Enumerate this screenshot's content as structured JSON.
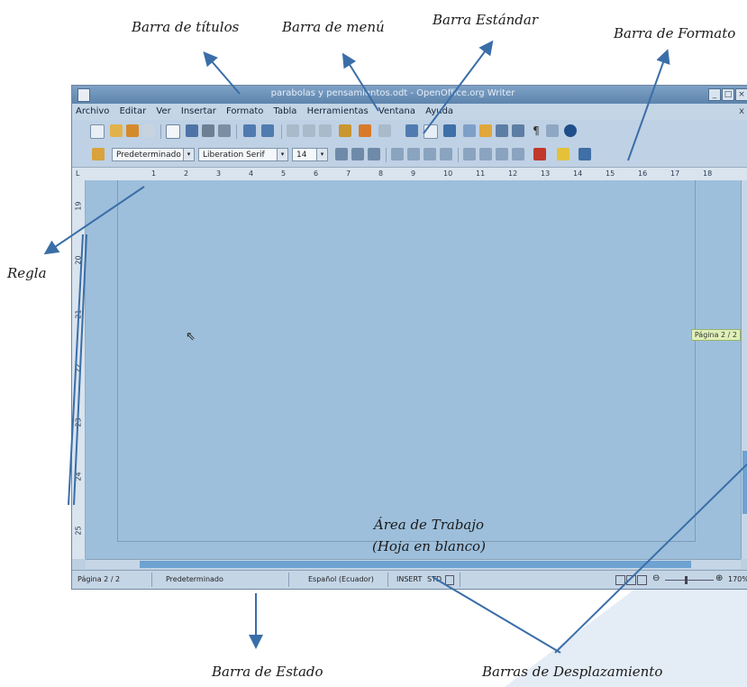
{
  "annotations": {
    "titulos": "Barra de títulos",
    "menu": "Barra de menú",
    "estandar": "Barra Estándar",
    "formato": "Barra de Formato",
    "regla": "Regla",
    "estado": "Barra de Estado",
    "desplazamiento": "Barras de Desplazamiento",
    "area_line1": "Área de Trabajo",
    "area_line2": "(Hoja en blanco)"
  },
  "window": {
    "title": "parabolas y pensamientos.odt - OpenOffice.org Writer"
  },
  "menu": {
    "items": [
      "Archivo",
      "Editar",
      "Ver",
      "Insertar",
      "Formato",
      "Tabla",
      "Herramientas",
      "Ventana",
      "Ayuda"
    ],
    "close": "x"
  },
  "format_bar": {
    "style": "Predeterminado",
    "font": "Liberation Serif",
    "size": "14"
  },
  "ruler": {
    "ticks": [
      "1",
      "2",
      "3",
      "4",
      "5",
      "6",
      "7",
      "8",
      "9",
      "10",
      "11",
      "12",
      "13",
      "14",
      "15",
      "16",
      "17",
      "18"
    ]
  },
  "vruler": {
    "ticks": [
      "19",
      "20",
      "21",
      "22",
      "23",
      "24",
      "25"
    ]
  },
  "workarea": {
    "page_badge": "Página 2 / 2"
  },
  "status": {
    "page": "Página 2 / 2",
    "style": "Predeterminado",
    "language": "Español (Ecuador)",
    "insert": "INSERT",
    "std": "STD",
    "zoom": "170%"
  },
  "colors": {
    "workarea": "#9dbfdb",
    "toolbar": "#bfd1e4",
    "titlebar": "#5d84ad",
    "arrow": "#3a6ea8"
  }
}
